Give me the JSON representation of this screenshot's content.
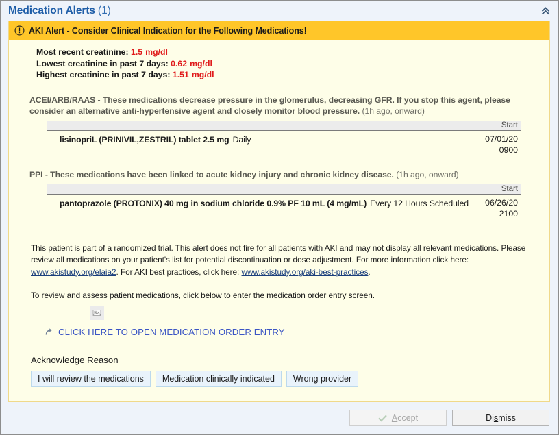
{
  "window": {
    "title": "Medication Alerts",
    "count": "(1)",
    "collapse_icon": "double-chevron-up-icon"
  },
  "banner": {
    "icon": "warning-exclamation-circle-icon",
    "text": "AKI Alert - Consider Clinical Indication for the Following Medications!"
  },
  "labs": [
    {
      "label": "Most recent creatinine:",
      "value": "1.5",
      "unit": "mg/dl"
    },
    {
      "label": "Lowest creatinine in past 7 days:",
      "value": "0.62",
      "unit": "mg/dl"
    },
    {
      "label": "Highest creatinine in past 7 days:",
      "value": "1.51",
      "unit": "mg/dl"
    }
  ],
  "classes": [
    {
      "description": "ACEI/ARB/RAAS - These medications decrease pressure in the glomerulus, decreasing GFR. If you stop this agent, please consider an alternative anti-hypertensive agent and closely monitor blood pressure.",
      "when": "(1h ago, onward)",
      "column_header": "Start",
      "med_name": "lisinopriL (PRINIVIL,ZESTRIL) tablet 2.5 mg",
      "med_sig": "Daily",
      "start_date": "07/01/20",
      "start_time": "0900"
    },
    {
      "description": "PPI - These medications have been linked to acute kidney injury and chronic kidney disease.",
      "when": "(1h ago, onward)",
      "column_header": "Start",
      "med_name": "pantoprazole (PROTONIX) 40 mg in sodium chloride 0.9% PF 10 mL (4 mg/mL)",
      "med_sig": "Every 12 Hours Scheduled",
      "start_date": "06/26/20",
      "start_time": "2100"
    }
  ],
  "info": {
    "part1": "This patient is part of a randomized trial.  This alert does not fire for all patients with AKI and may not display all relevant medications.  Please review all medications on your patient's list for potential discontinuation or dose adjustment. For more information click here: ",
    "link1": "www.akistudy.org/elaia2",
    "part2": ".  For AKI best practices, click here: ",
    "link2": "www.akistudy.org/aki-best-practices",
    "part3": ".",
    "subtext": "To review and assess patient medications, click below to enter the medication order entry screen."
  },
  "order_entry": {
    "icon": "shortcut-arrow-icon",
    "placeholder_icon": "broken-image-icon",
    "link_label": "CLICK HERE TO OPEN MEDICATION ORDER ENTRY"
  },
  "acknowledge": {
    "legend": "Acknowledge Reason",
    "options": [
      "I will review the medications",
      "Medication clinically indicated",
      "Wrong provider"
    ]
  },
  "footer": {
    "accept": {
      "label": "Accept",
      "accel": "A",
      "rest": "ccept",
      "icon": "checkmark-icon",
      "disabled": true
    },
    "dismiss": {
      "label": "Dismiss",
      "pre": "Di",
      "accel": "s",
      "rest": "miss"
    }
  }
}
